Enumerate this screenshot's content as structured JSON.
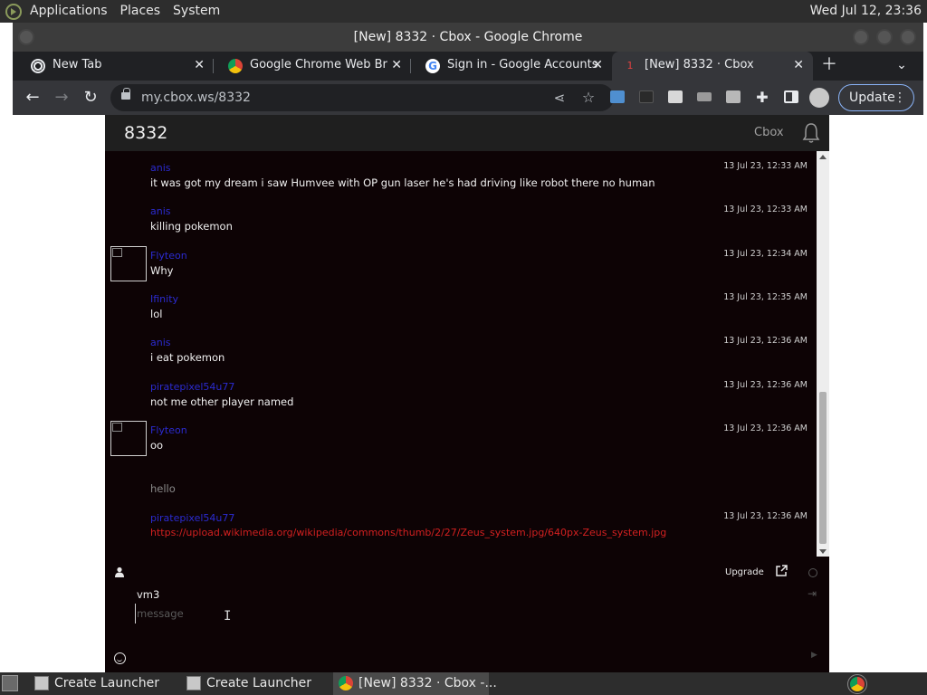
{
  "top_panel": {
    "menus": [
      "Applications",
      "Places",
      "System"
    ],
    "clock": "Wed Jul 12, 23:36"
  },
  "window": {
    "title": "[New] 8332 · Cbox - Google Chrome"
  },
  "tabs": [
    {
      "label": "New Tab",
      "icon": "chrome-icon"
    },
    {
      "label": "Google Chrome Web Brow",
      "icon": "chrome-icon"
    },
    {
      "label": "Sign in - Google Accounts",
      "icon": "google-icon"
    },
    {
      "label": "[New] 8332 · Cbox",
      "icon": "cbox-icon",
      "active": true
    }
  ],
  "toolbar": {
    "url": "my.cbox.ws/8332",
    "update_label": "Update"
  },
  "cbox": {
    "room_title": "8332",
    "link_label": "Cbox",
    "messages": [
      {
        "name": "anis",
        "time": "13 Jul 23, 12:33 AM",
        "text": "it was got my dream i saw Humvee with OP gun laser he's had driving like robot there no human",
        "avatar": false,
        "style": "normal"
      },
      {
        "name": "anis",
        "time": "13 Jul 23, 12:33 AM",
        "text": "killing pokemon",
        "avatar": false,
        "style": "normal"
      },
      {
        "name": "Flyteon",
        "time": "13 Jul 23, 12:34 AM",
        "text": "Why",
        "avatar": true,
        "style": "normal"
      },
      {
        "name": "Ifinity",
        "time": "13 Jul 23, 12:35 AM",
        "text": "lol",
        "avatar": false,
        "style": "normal"
      },
      {
        "name": "anis",
        "time": "13 Jul 23, 12:36 AM",
        "text": "i eat pokemon",
        "avatar": false,
        "style": "normal"
      },
      {
        "name": "piratepixel54u77",
        "time": "13 Jul 23, 12:36 AM",
        "text": "not me other player named",
        "avatar": false,
        "style": "normal"
      },
      {
        "name": "Flyteon",
        "time": "13 Jul 23, 12:36 AM",
        "text": "oo",
        "avatar": true,
        "style": "normal"
      },
      {
        "name": "",
        "time": "",
        "text": "hello",
        "avatar": false,
        "style": "dim"
      },
      {
        "name": "piratepixel54u77",
        "time": "13 Jul 23, 12:36 AM",
        "text": "https://upload.wikimedia.org/wikipedia/commons/thumb/2/27/Zeus_system.jpg/640px-Zeus_system.jpg",
        "avatar": false,
        "style": "link"
      }
    ],
    "upgrade_label": "Upgrade",
    "nickname": "vm3",
    "message_placeholder": "message"
  },
  "taskbar": {
    "tasks": [
      {
        "label": "Create Launcher"
      },
      {
        "label": "Create Launcher"
      },
      {
        "label": "[New] 8332 · Cbox -..."
      }
    ]
  },
  "colors": {
    "chat_bg": "#0d0305",
    "username": "#2b2bd0",
    "link": "#d22020",
    "update_border": "#8ab4f8"
  }
}
